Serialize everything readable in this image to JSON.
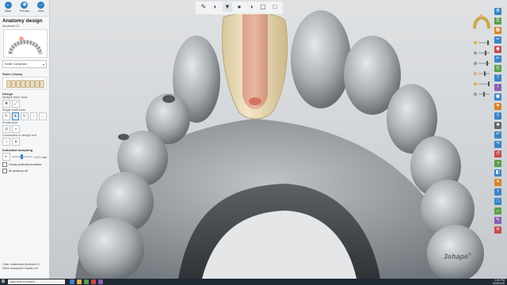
{
  "left_panel": {
    "top_buttons": [
      {
        "label": "Back",
        "icon": "back-arrow-icon"
      },
      {
        "label": "Preview",
        "icon": "eye-icon"
      },
      {
        "label": "Next",
        "icon": "forward-arrow-icon"
      }
    ],
    "title": "Anatomy design",
    "subtitle": "Abutment 11",
    "library_select": "Smile Composer",
    "library_section": "Smile Library",
    "design_section": "Design",
    "multiple_teeth_label": "Multiple teeth tools",
    "single_tooth_label": "Single tooth tools",
    "smart_tools_label": "Smart tools",
    "connectors_label": "Connectors to design tool",
    "morphing_section": "Individual morphing",
    "morph_value": "0.17 mm",
    "create_protected_label": "Create protected surfaces",
    "all_anatomy_label": "All anatomy off",
    "footer_order": "Order: Anatomical Abutment 11",
    "footer_client": "Client: Advanced Ceramic Ltd"
  },
  "top_toolbar": {
    "icons": [
      "brush-icon",
      "smooth-icon",
      "tooth-selected-icon",
      "scan-icon",
      "color-icon",
      "mesh-icon",
      "hide-icon"
    ]
  },
  "right_tools": {
    "visibility_sliders": 6,
    "icons": [
      "settings-icon",
      "layers-icon",
      "grid-icon",
      "ruler-icon",
      "camera-icon",
      "clip-icon",
      "view-icon",
      "help-icon",
      "info-icon",
      "scan-icon",
      "tooth-icon",
      "export-icon",
      "lock-icon",
      "undo-icon",
      "redo-icon",
      "reset-icon",
      "palette-icon",
      "section-icon",
      "light-icon",
      "zoom-icon",
      "fit-icon",
      "measure-icon",
      "note-icon",
      "close-icon"
    ]
  },
  "brand": "3shape",
  "taskbar": {
    "search_placeholder": "Type here to search",
    "time": "1:52 PM",
    "date": "9/26/2018"
  },
  "colors": {
    "accent": "#2f7fc1",
    "crown": "#ecdcb5",
    "abutment": "#e8a08a",
    "model": "#9da2a6"
  }
}
